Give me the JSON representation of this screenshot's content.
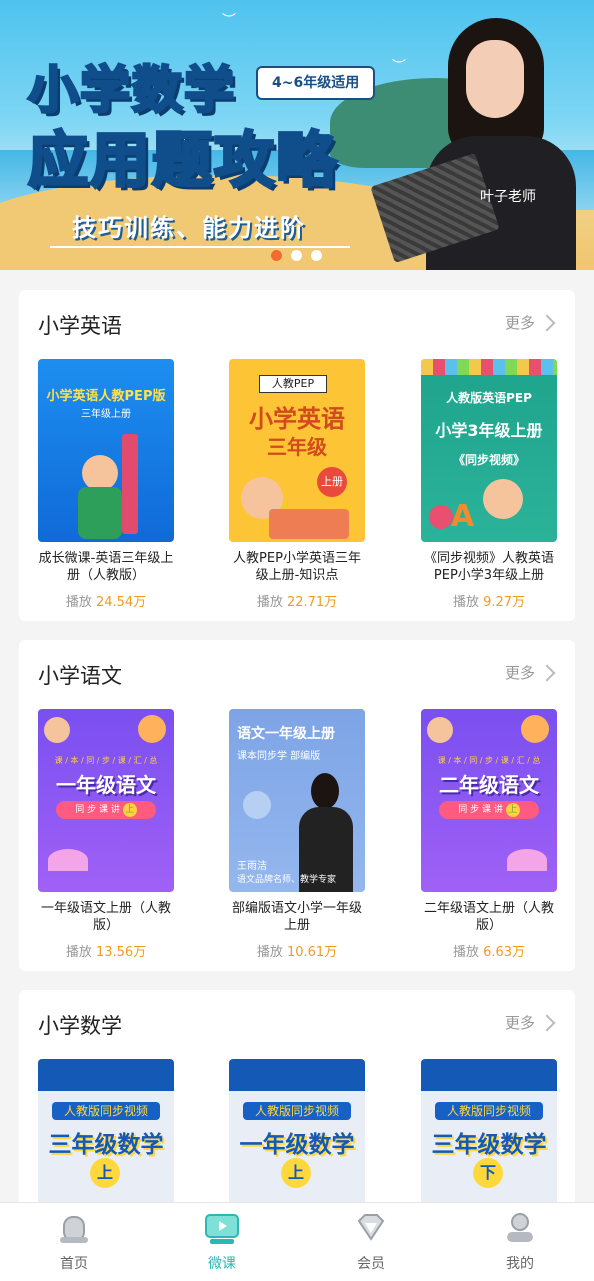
{
  "banner": {
    "title_line1": "小学数学",
    "title_line2": "应用题攻略",
    "grade_tag": "4~6年级适用",
    "subtitle": "技巧训练、能力进阶",
    "teacher_name": "叶子老师",
    "pager": {
      "count": 3,
      "active_index": 0
    }
  },
  "sections": [
    {
      "title": "小学英语",
      "more_label": "更多",
      "items": [
        {
          "title": "成长微课-英语三年级上册（人教版）",
          "plays_label": "播放",
          "plays": "24.54万",
          "cover": {
            "line1": "小学英语人教PEP版",
            "line2": "三年级上册"
          }
        },
        {
          "title": "人教PEP小学英语三年级上册-知识点",
          "plays_label": "播放",
          "plays": "22.71万",
          "cover": {
            "tag": "人教PEP",
            "line1": "小学英语",
            "line2": "三年级",
            "badge": "上册"
          }
        },
        {
          "title": "《同步视频》人教英语PEP小学3年级上册",
          "plays_label": "播放",
          "plays": "9.27万",
          "cover": {
            "line1": "人教版英语PEP",
            "line2": "小学3年级上册",
            "line3": "《同步视频》"
          }
        }
      ]
    },
    {
      "title": "小学语文",
      "more_label": "更多",
      "items": [
        {
          "title": "一年级语文上册（人教版）",
          "plays_label": "播放",
          "plays": "13.56万",
          "cover": {
            "top": "课 / 本 / 同 / 步 / 课 / 汇 / 总",
            "line1": "一年级语文",
            "ribbon": "同 步 课 讲",
            "badge": "上"
          }
        },
        {
          "title": "部编版语文小学一年级上册",
          "plays_label": "播放",
          "plays": "10.61万",
          "cover": {
            "line1": "语文一年级上册",
            "line2": "课本同步学 部编版",
            "teacher": "王雨洁",
            "teacher_desc": "语文品牌名师、教学专家"
          }
        },
        {
          "title": "二年级语文上册（人教版）",
          "plays_label": "播放",
          "plays": "6.63万",
          "cover": {
            "top": "课 / 本 / 同 / 步 / 课 / 汇 / 总",
            "line1": "二年级语文",
            "ribbon": "同 步 课 讲",
            "badge": "上"
          }
        }
      ]
    },
    {
      "title": "小学数学",
      "more_label": "更多",
      "items": [
        {
          "cover": {
            "band": "人教版同步视频",
            "line1": "三年级数学",
            "badge": "上"
          }
        },
        {
          "cover": {
            "band": "人教版同步视频",
            "line1": "一年级数学",
            "badge": "上"
          }
        },
        {
          "cover": {
            "band": "人教版同步视频",
            "line1": "三年级数学",
            "badge": "下"
          }
        }
      ]
    }
  ],
  "tabbar": [
    {
      "label": "首页",
      "icon": "home-icon",
      "active": false
    },
    {
      "label": "微课",
      "icon": "video-lesson-icon",
      "active": true
    },
    {
      "label": "会员",
      "icon": "diamond-icon",
      "active": false
    },
    {
      "label": "我的",
      "icon": "profile-icon",
      "active": false
    }
  ],
  "colors": {
    "accent": "#2bb7b3",
    "play_count": "#f29b1f",
    "pager_active": "#f26a2e"
  }
}
